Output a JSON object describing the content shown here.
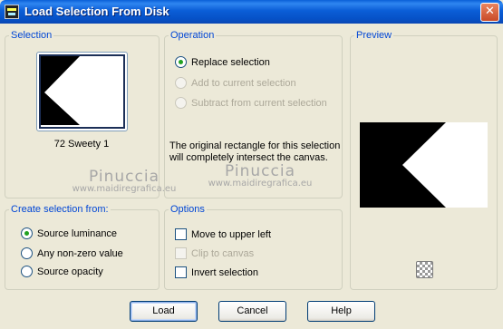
{
  "window": {
    "title": "Load Selection From Disk",
    "close_symbol": "✕"
  },
  "selection": {
    "legend": "Selection",
    "thumbnail_label": "72 Sweety 1"
  },
  "operation": {
    "legend": "Operation",
    "options": [
      {
        "label": "Replace selection",
        "checked": true,
        "enabled": true
      },
      {
        "label": "Add to current selection",
        "checked": false,
        "enabled": false
      },
      {
        "label": "Subtract from current selection",
        "checked": false,
        "enabled": false
      }
    ],
    "note": "The original rectangle for this selection will completely intersect the canvas."
  },
  "preview": {
    "legend": "Preview"
  },
  "create_from": {
    "legend": "Create selection from:",
    "options": [
      {
        "label": "Source luminance",
        "checked": true
      },
      {
        "label": "Any non-zero value",
        "checked": false
      },
      {
        "label": "Source opacity",
        "checked": false
      }
    ]
  },
  "options": {
    "legend": "Options",
    "items": [
      {
        "label": "Move to upper left",
        "checked": false,
        "enabled": true
      },
      {
        "label": "Clip to canvas",
        "checked": false,
        "enabled": false
      },
      {
        "label": "Invert selection",
        "checked": false,
        "enabled": true
      }
    ]
  },
  "watermarks": [
    {
      "name": "Pinuccia",
      "site": "www.maidiregrafica.eu"
    },
    {
      "name": "Pinuccia",
      "site": "www.maidiregrafica.eu"
    }
  ],
  "buttons": {
    "load": "Load",
    "cancel": "Cancel",
    "help": "Help"
  },
  "colors": {
    "title_bar": "#0b5ed7",
    "group_legend": "#0046d5",
    "radio_dot": "#21a121",
    "dialog_bg": "#ece9d8"
  },
  "icons": {
    "app": "psp-app-icon",
    "close": "close-icon",
    "checker": "transparency-checker-icon"
  }
}
